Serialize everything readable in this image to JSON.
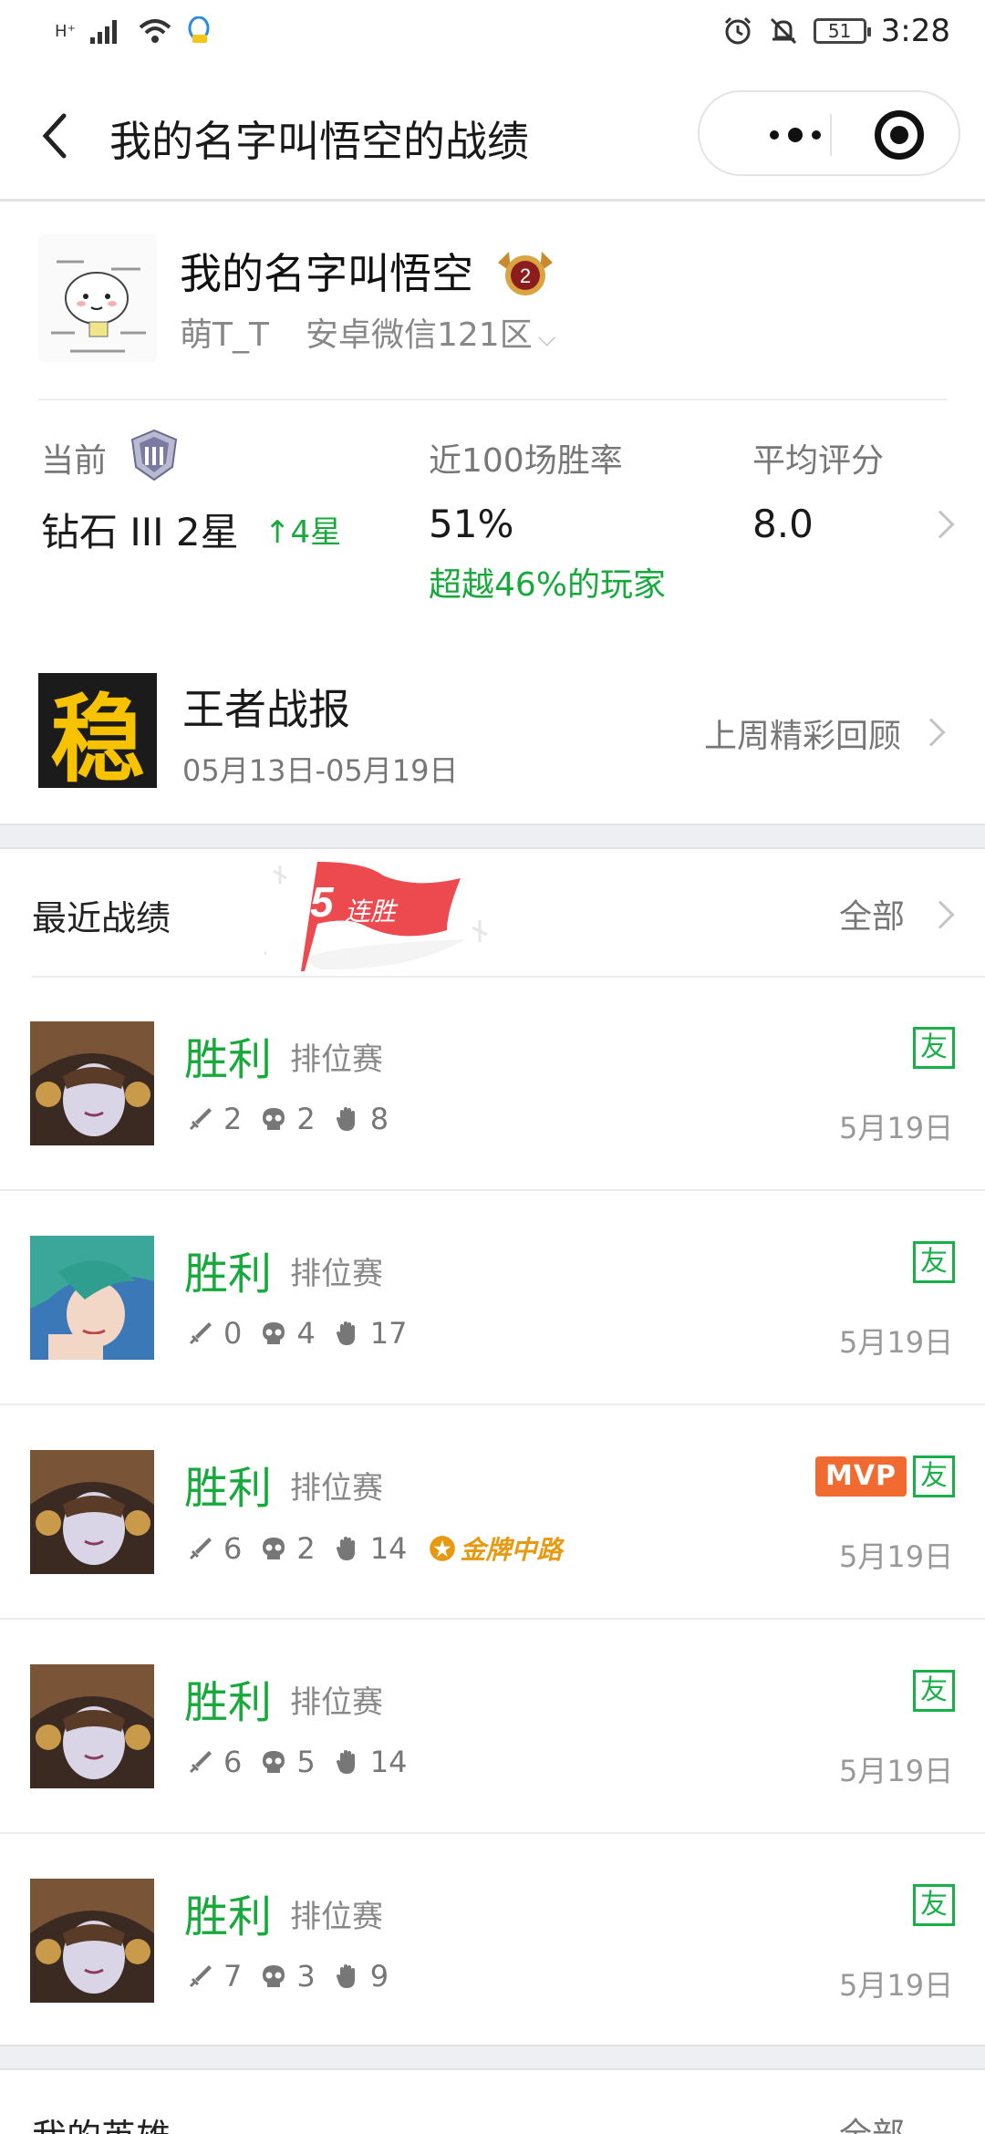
{
  "status_bar": {
    "network": "H⁺",
    "time": "3:28",
    "battery": "51"
  },
  "nav": {
    "title": "我的名字叫悟空的战绩"
  },
  "profile": {
    "name": "我的名字叫悟空",
    "rank_level": "2",
    "nickname": "萌T_T",
    "server": "安卓微信121区"
  },
  "stats": {
    "current_label": "当前",
    "current_value": "钻石 III 2星",
    "star_change": "↑4星",
    "winrate_label": "近100场胜率",
    "winrate_value": "51%",
    "beat_text": "超越46%的玩家",
    "rating_label": "平均评分",
    "rating_value": "8.0"
  },
  "weekly_report": {
    "logo_char": "稳",
    "title": "王者战报",
    "date_range": "05月13日-05月19日",
    "review_link": "上周精彩回顾"
  },
  "recent": {
    "title": "最近战绩",
    "streak_count": "5",
    "streak_label": "连胜",
    "all_link": "全部",
    "matches": [
      {
        "result": "胜利",
        "mode": "排位赛",
        "kills": "2",
        "deaths": "2",
        "assists": "8",
        "date": "5月19日",
        "friend_badge": "友"
      },
      {
        "result": "胜利",
        "mode": "排位赛",
        "kills": "0",
        "deaths": "4",
        "assists": "17",
        "date": "5月19日",
        "friend_badge": "友"
      },
      {
        "result": "胜利",
        "mode": "排位赛",
        "kills": "6",
        "deaths": "2",
        "assists": "14",
        "date": "5月19日",
        "friend_badge": "友",
        "mvp": "MVP",
        "medal": "金牌中路"
      },
      {
        "result": "胜利",
        "mode": "排位赛",
        "kills": "6",
        "deaths": "5",
        "assists": "14",
        "date": "5月19日",
        "friend_badge": "友"
      },
      {
        "result": "胜利",
        "mode": "排位赛",
        "kills": "7",
        "deaths": "3",
        "assists": "9",
        "date": "5月19日",
        "friend_badge": "友"
      }
    ]
  },
  "heroes": {
    "title": "我的英雄",
    "all_link": "全部"
  },
  "colors": {
    "win_green": "#18a93d",
    "friend_green": "#19b04a",
    "mvp_orange": "#f16a2f",
    "streak_red": "#ec4a4f"
  }
}
